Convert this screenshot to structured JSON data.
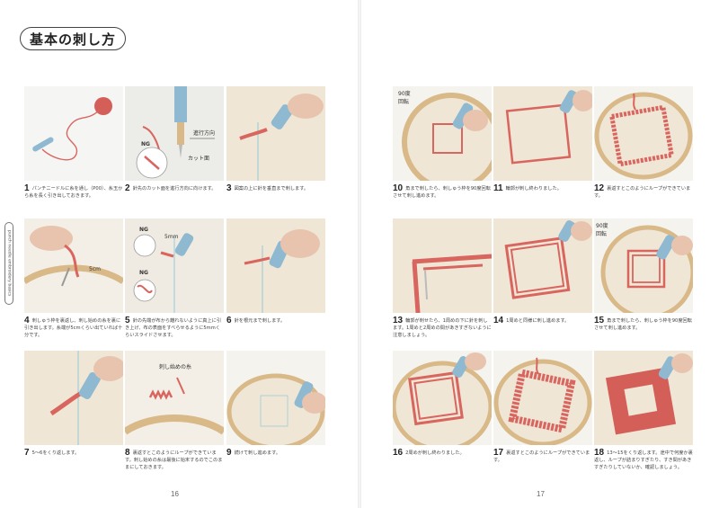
{
  "title": "基本の刺し方",
  "side_tab": "punch needle embroidery basics",
  "page_numbers": {
    "left": "16",
    "right": "17"
  },
  "labels": {
    "ng": "NG",
    "direction": "進行方向",
    "cut_face": "カット面",
    "five_cm": "5cm",
    "five_mm": "5mm",
    "ninety_deg": "90度",
    "rotate": "回転",
    "start_thread": "刺し始めの糸"
  },
  "steps": [
    {
      "num": "1",
      "text": "パンチニードルに糸を通し（P00）、糸玉から糸を長く引き出しておきます。"
    },
    {
      "num": "2",
      "text": "針先のカット面を進行方向に向けます。"
    },
    {
      "num": "3",
      "text": "図案の上に針を垂直まで刺します。"
    },
    {
      "num": "4",
      "text": "刺しゅう枠を裏返し、刺し始めの糸を裏に引き出します。糸端が5cmくらい出ていれば十分です。"
    },
    {
      "num": "5",
      "text": "針の先端が布から離れないように真上に引き上げ、布の表面をすべらせるように5mmくらいスライドさせます。"
    },
    {
      "num": "6",
      "text": "針を根元まで刺します。"
    },
    {
      "num": "7",
      "text": "5〜6をくり返します。"
    },
    {
      "num": "8",
      "text": "裏返すとこのようにループができています。刺し始めの糸は最後に始末するのでこのままにしておきます。"
    },
    {
      "num": "9",
      "text": "続けて刺し進めます。"
    },
    {
      "num": "10",
      "text": "角まで刺したら、刺しゅう枠を90度回転させて刺し進めます。"
    },
    {
      "num": "11",
      "text": "輪郭が刺し終わりました。"
    },
    {
      "num": "12",
      "text": "裏返すとこのようにループができています。"
    },
    {
      "num": "13",
      "text": "輪郭が刺せたら、1周めの下に針を刺します。1周めと2周めの間があきすぎないように注意しましょう。"
    },
    {
      "num": "14",
      "text": "1周めと同様に刺し進めます。"
    },
    {
      "num": "15",
      "text": "角まで刺したら、刺しゅう枠を90度回転させて刺し進めます。"
    },
    {
      "num": "16",
      "text": "2周めが刺し終わりました。"
    },
    {
      "num": "17",
      "text": "裏返すとこのようにループができています。"
    },
    {
      "num": "18",
      "text": "13〜15をくり返します。途中で何度か裏返し、ループが詰まりすぎたり、すき間があきすぎたりしていないか、確認しましょう。"
    }
  ],
  "colors": {
    "yarn": "#d9655f",
    "needle": "#8fb9d0",
    "fabric": "#efe6d6",
    "hoop": "#d8b987",
    "line": "#7fc3d9"
  }
}
